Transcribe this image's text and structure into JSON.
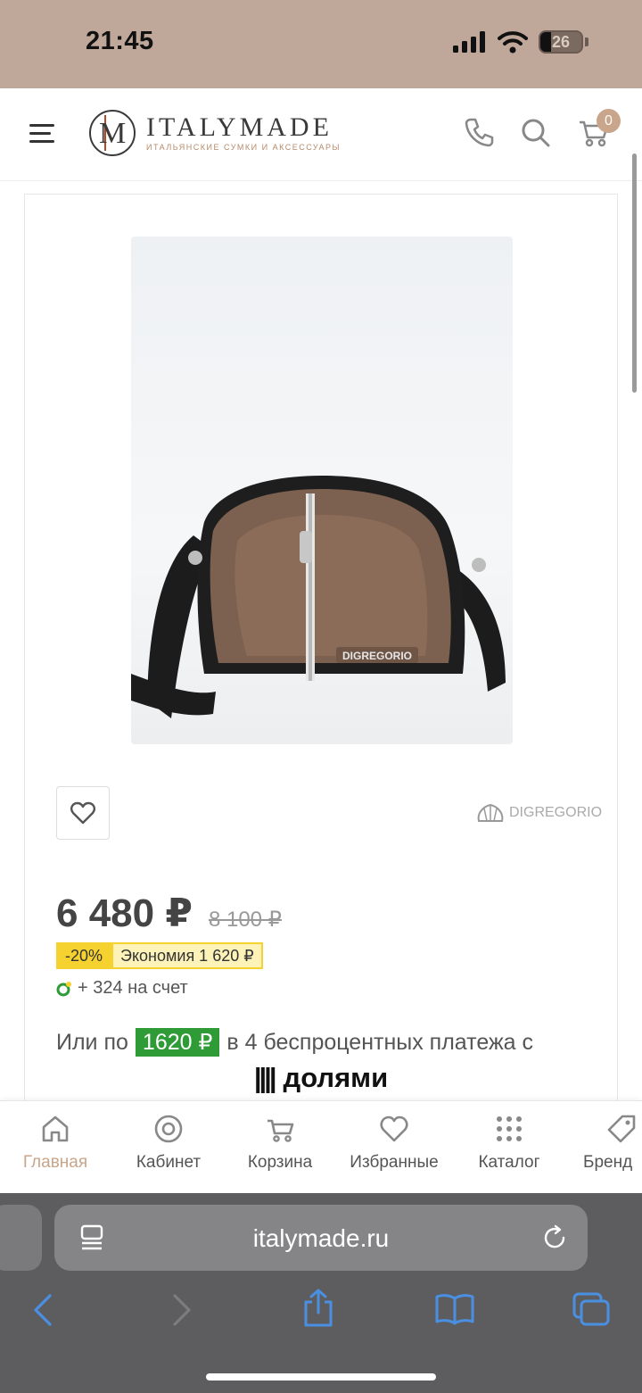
{
  "status_bar": {
    "time": "21:45",
    "battery": "26",
    "battery_level": 0.26
  },
  "header": {
    "logo_title": "ITALYMADE",
    "logo_subtitle": "ИТАЛЬЯНСКИЕ СУМКИ И АКСЕССУАРЫ",
    "cart_count": "0"
  },
  "product": {
    "image_brand_text": "DIGREGORIO",
    "brand_logo_text": "DIGREGORIO",
    "price": "6 480 ₽",
    "old_price": "8 100 ₽",
    "discount": "-20%",
    "economy": "Экономия 1 620 ₽",
    "bonus": "+ 324 на счет",
    "installment_prefix": "Или по",
    "installment_amount": "1620 ₽",
    "installment_suffix": "в 4 беспроцентных платежа с",
    "installment_service": "долями"
  },
  "bottom_nav": [
    {
      "label": "Главная",
      "icon": "home-icon",
      "active": true
    },
    {
      "label": "Кабинет",
      "icon": "user-circle-icon",
      "active": false
    },
    {
      "label": "Корзина",
      "icon": "cart-icon",
      "active": false
    },
    {
      "label": "Избранные",
      "icon": "heart-icon",
      "active": false
    },
    {
      "label": "Каталог",
      "icon": "grid-icon",
      "active": false
    },
    {
      "label": "Бренд",
      "icon": "tag-icon",
      "active": false
    }
  ],
  "browser": {
    "url": "italymade.ru"
  },
  "colors": {
    "accent": "#c9a58b",
    "status_bar": "#bfa89a",
    "installment_green": "#2e9b36",
    "discount_yellow": "#f5d230"
  }
}
